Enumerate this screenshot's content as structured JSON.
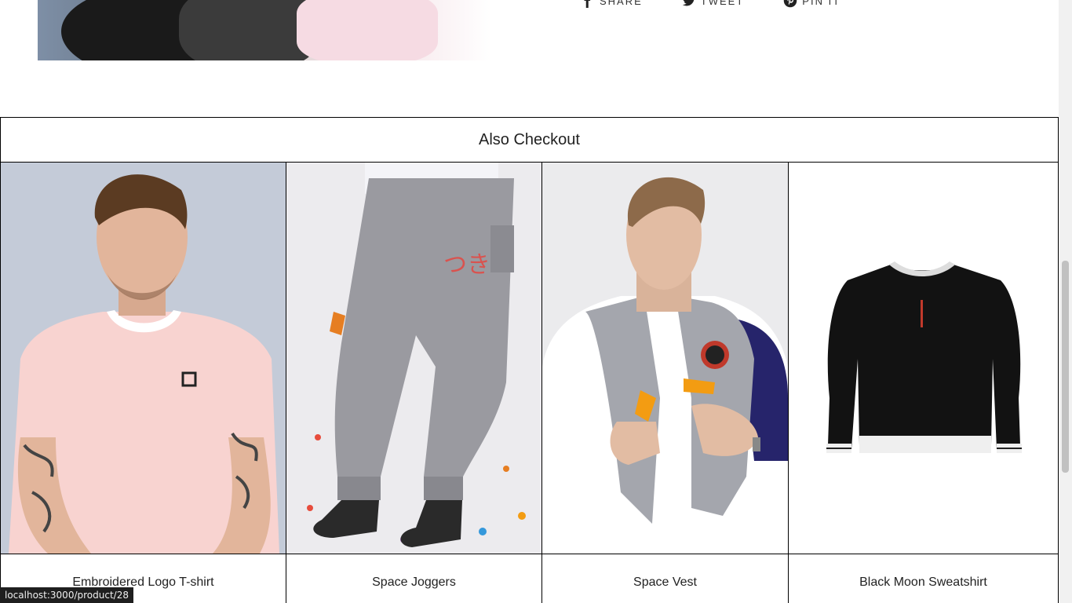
{
  "share": [
    {
      "label": "SHARE",
      "icon": "facebook-icon"
    },
    {
      "label": "TWEET",
      "icon": "twitter-icon"
    },
    {
      "label": "PIN IT",
      "icon": "pinterest-icon"
    }
  ],
  "also_checkout": {
    "title": "Also Checkout",
    "products": [
      {
        "name": "Embroidered Logo T-shirt"
      },
      {
        "name": "Space Joggers"
      },
      {
        "name": "Space Vest"
      },
      {
        "name": "Black Moon Sweatshirt"
      }
    ]
  },
  "status_bar": {
    "url": "localhost:3000/product/28"
  },
  "colors": {
    "border": "#000000",
    "background": "#ffffff"
  }
}
